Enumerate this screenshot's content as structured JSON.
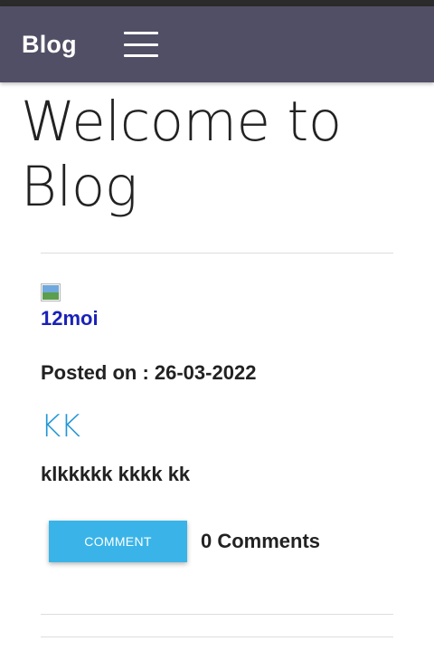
{
  "colors": {
    "navbar": "#514f65",
    "accent": "#3ab4e8",
    "link": "#1a22b8",
    "post_title": "#2196d6"
  },
  "navbar": {
    "brand": "Blog",
    "menu_icon": "hamburger-menu-icon"
  },
  "hero": {
    "title_line1": "Welcome to",
    "title_line2": "Blog"
  },
  "post": {
    "image_icon": "broken-image-icon",
    "author": "12moi",
    "posted_on": "Posted on : 26-03-2022",
    "title": "KK",
    "body": "klkkkkk kkkk kk",
    "comment_button": "COMMENT",
    "comments_count": "0 Comments"
  }
}
